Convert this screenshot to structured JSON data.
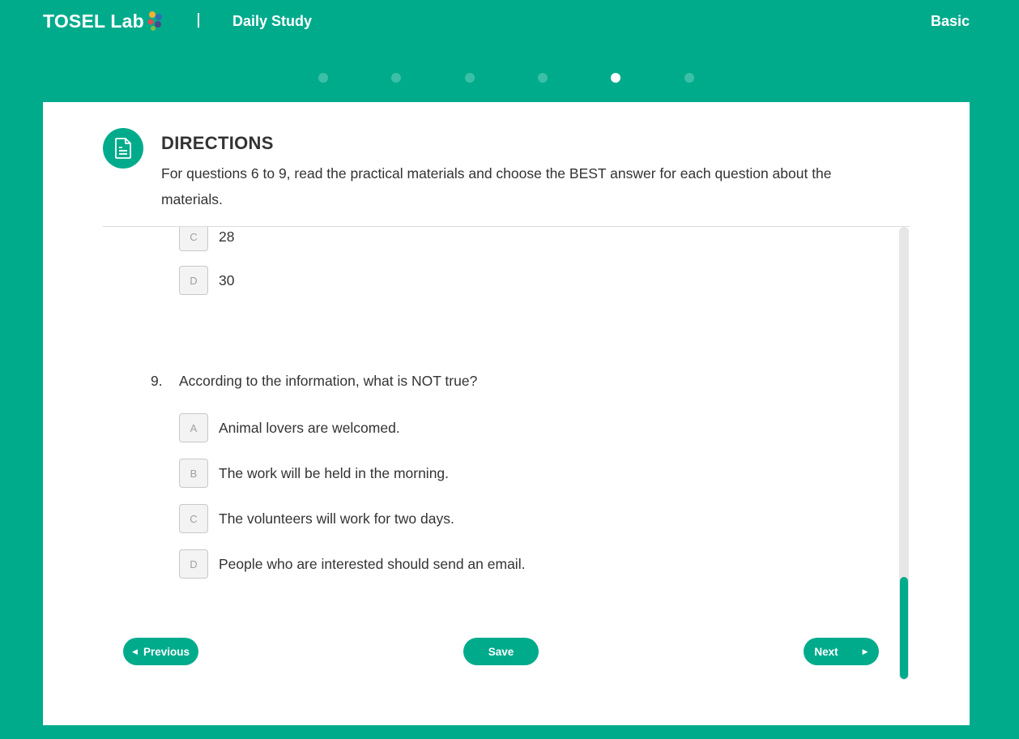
{
  "header": {
    "brand": "TOSEL Lab",
    "section": "Daily Study",
    "level": "Basic"
  },
  "progress": {
    "total_steps": 6,
    "current_step": 5
  },
  "directions": {
    "title": "DIRECTIONS",
    "text": "For questions 6 to 9, read the practical materials and choose the BEST answer for each question about the materials."
  },
  "previous_question_options": [
    {
      "letter": "C",
      "text": "28"
    },
    {
      "letter": "D",
      "text": "30"
    }
  ],
  "question": {
    "number": "9.",
    "text": "According to the information, what is NOT true?",
    "options": [
      {
        "letter": "A",
        "text": "Animal lovers are welcomed."
      },
      {
        "letter": "B",
        "text": "The work will be held in the morning."
      },
      {
        "letter": "C",
        "text": "The volunteers will work for two days."
      },
      {
        "letter": "D",
        "text": "People who are interested should send an email."
      }
    ]
  },
  "buttons": {
    "previous": "Previous",
    "save": "Save",
    "next": "Next"
  },
  "colors": {
    "accent": "#00ab8c",
    "dot_inactive": "#3bc0a7",
    "dot_active": "#ffffff"
  }
}
